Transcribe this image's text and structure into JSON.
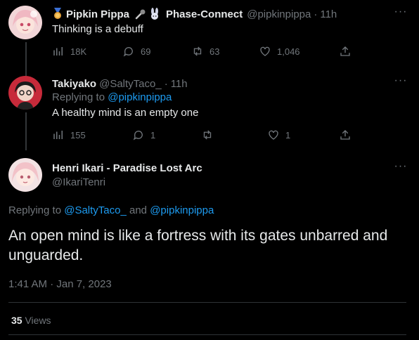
{
  "tweet1": {
    "name": "Pipkin Pippa",
    "name2": "Phase-Connect",
    "handle": "@pipkinpippa",
    "time": "11h",
    "text": "Thinking is a debuff",
    "stats": {
      "views": "18K",
      "replies": "69",
      "retweets": "63",
      "likes": "1,046"
    }
  },
  "tweet2": {
    "name": "Takiyako",
    "handle": "@SaltyTaco_",
    "time": "11h",
    "replying_prefix": "Replying to ",
    "replying_to": "@pipkinpippa",
    "text": "A healthy mind is an empty one",
    "stats": {
      "views": "155",
      "replies": "1",
      "retweets": "",
      "likes": "1"
    }
  },
  "main": {
    "name": "Henri Ikari - Paradise Lost Arc",
    "handle": "@IkariTenri",
    "replying_prefix": "Replying to ",
    "replying_to_1": "@SaltyTaco_",
    "replying_and": " and ",
    "replying_to_2": "@pipkinpippa",
    "text": "An open mind is like a fortress with its gates unbarred and unguarded.",
    "timestamp": "1:41 AM · Jan 7, 2023",
    "views_count": "35",
    "views_label": "Views"
  },
  "more_glyph": "···",
  "colors": {
    "bg": "#000000",
    "text": "#e7e9ea",
    "muted": "#71767b",
    "link": "#1d9bf0",
    "divider": "#2f3336"
  }
}
